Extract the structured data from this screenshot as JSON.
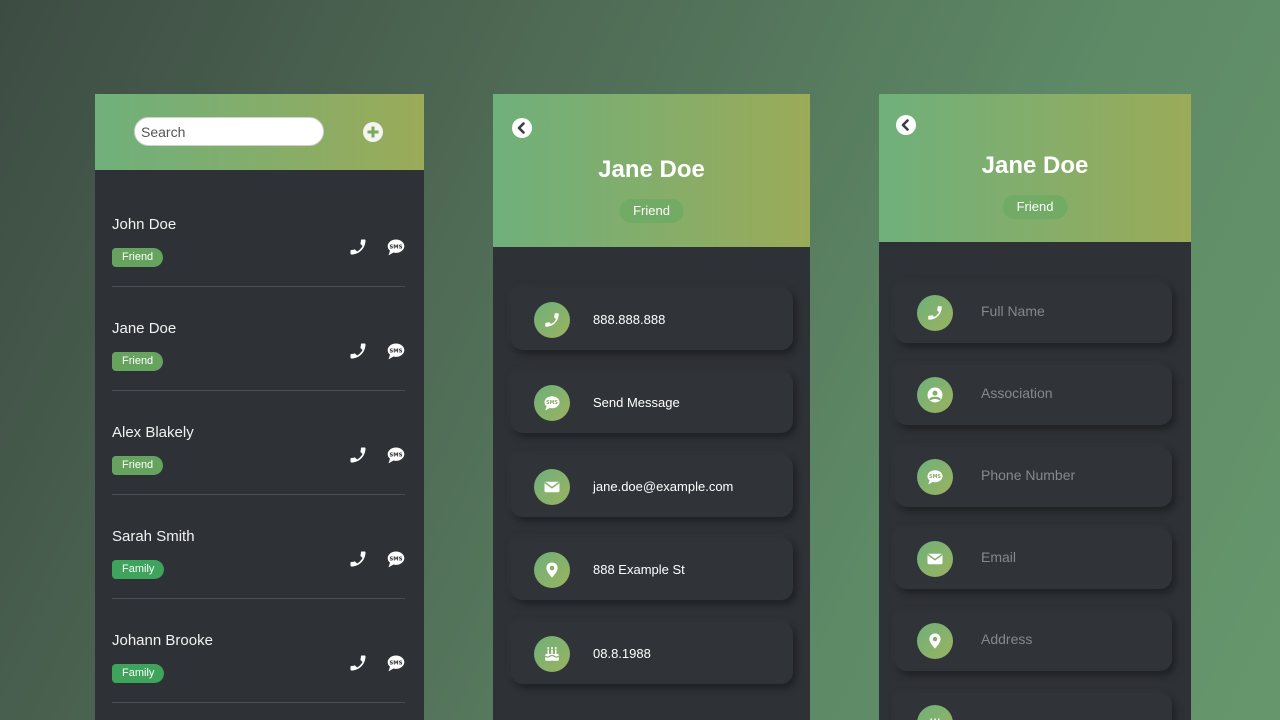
{
  "colors": {
    "accent_start": "#6fb07b",
    "accent_end": "#9bab58",
    "panel_bg": "#2e3135",
    "tag_friend": "#66a35f",
    "tag_family": "#3ea35b"
  },
  "list": {
    "search_placeholder": "Search",
    "add_icon": "plus-circle-icon",
    "contacts": [
      {
        "name": "John Doe",
        "tag": "Friend"
      },
      {
        "name": "Jane Doe",
        "tag": "Friend"
      },
      {
        "name": "Alex Blakely",
        "tag": "Friend"
      },
      {
        "name": "Sarah Smith",
        "tag": "Family"
      },
      {
        "name": "Johann Brooke",
        "tag": "Family"
      }
    ]
  },
  "detail": {
    "name": "Jane Doe",
    "tag": "Friend",
    "items": [
      {
        "icon": "phone-icon",
        "text": "888.888.888"
      },
      {
        "icon": "sms-icon",
        "text": "Send Message"
      },
      {
        "icon": "envelope-icon",
        "text": "jane.doe@example.com"
      },
      {
        "icon": "map-pin-icon",
        "text": "888 Example St"
      },
      {
        "icon": "birthday-cake-icon",
        "text": "08.8.1988"
      }
    ]
  },
  "edit": {
    "name": "Jane Doe",
    "tag": "Friend",
    "fields": [
      {
        "icon": "phone-icon",
        "placeholder": "Full Name"
      },
      {
        "icon": "user-circle-icon",
        "placeholder": "Association"
      },
      {
        "icon": "sms-icon",
        "placeholder": "Phone Number"
      },
      {
        "icon": "envelope-icon",
        "placeholder": "Email"
      },
      {
        "icon": "map-pin-icon",
        "placeholder": "Address"
      }
    ]
  }
}
